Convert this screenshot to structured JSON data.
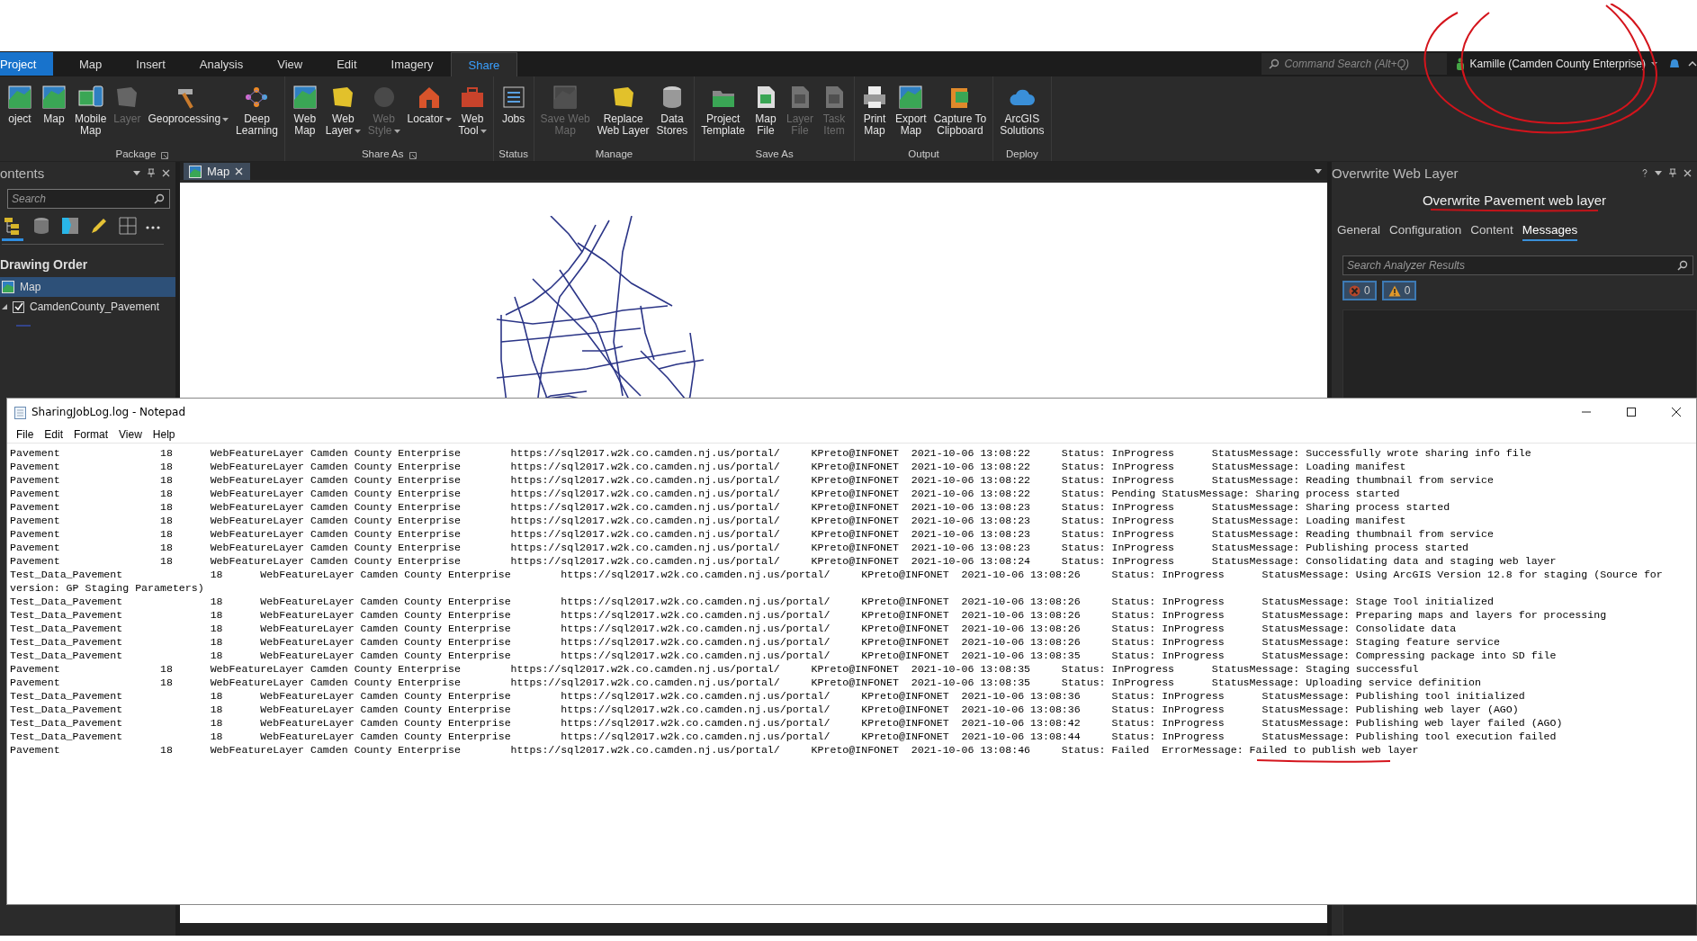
{
  "menu_tabs": [
    {
      "label": "Project",
      "kind": "backstage",
      "selected": false
    },
    {
      "label": "Map",
      "kind": "tab",
      "selected": false
    },
    {
      "label": "Insert",
      "kind": "tab",
      "selected": false
    },
    {
      "label": "Analysis",
      "kind": "tab",
      "selected": false
    },
    {
      "label": "View",
      "kind": "tab",
      "selected": false
    },
    {
      "label": "Edit",
      "kind": "tab",
      "selected": false
    },
    {
      "label": "Imagery",
      "kind": "tab",
      "selected": false
    },
    {
      "label": "Share",
      "kind": "tab",
      "selected": true
    }
  ],
  "command_search": {
    "placeholder": "Command Search (Alt+Q)"
  },
  "user": {
    "label": "Kamille (Camden County Enterprise)"
  },
  "ribbon_groups": [
    {
      "label": "Package",
      "launcher": true,
      "buttons": [
        {
          "label": "oject",
          "disabled": false,
          "dropdown": false
        },
        {
          "label": "Map",
          "disabled": false,
          "dropdown": false
        },
        {
          "label": "Mobile\nMap",
          "disabled": false,
          "dropdown": false
        },
        {
          "label": "Layer",
          "disabled": true,
          "dropdown": false
        },
        {
          "label": "Geoprocessing",
          "disabled": false,
          "dropdown": true
        },
        {
          "label": "Deep\nLearning",
          "disabled": false,
          "dropdown": false
        }
      ]
    },
    {
      "label": "Share As",
      "launcher": true,
      "buttons": [
        {
          "label": "Web\nMap",
          "disabled": false,
          "dropdown": false
        },
        {
          "label": "Web\nLayer",
          "disabled": false,
          "dropdown": true
        },
        {
          "label": "Web\nStyle",
          "disabled": true,
          "dropdown": true
        },
        {
          "label": "Locator",
          "disabled": false,
          "dropdown": true
        },
        {
          "label": "Web\nTool",
          "disabled": false,
          "dropdown": true
        }
      ]
    },
    {
      "label": "Status",
      "launcher": false,
      "buttons": [
        {
          "label": "Jobs",
          "disabled": false,
          "dropdown": false
        }
      ]
    },
    {
      "label": "Manage",
      "launcher": false,
      "buttons": [
        {
          "label": "Save Web\nMap",
          "disabled": true,
          "dropdown": false
        },
        {
          "label": "Replace\nWeb Layer",
          "disabled": false,
          "dropdown": false
        },
        {
          "label": "Data\nStores",
          "disabled": false,
          "dropdown": false
        }
      ]
    },
    {
      "label": "Save As",
      "launcher": false,
      "buttons": [
        {
          "label": "Project\nTemplate",
          "disabled": false,
          "dropdown": false
        },
        {
          "label": "Map\nFile",
          "disabled": false,
          "dropdown": false
        },
        {
          "label": "Layer\nFile",
          "disabled": true,
          "dropdown": false
        },
        {
          "label": "Task\nItem",
          "disabled": true,
          "dropdown": false
        }
      ]
    },
    {
      "label": "Output",
      "launcher": false,
      "buttons": [
        {
          "label": "Print\nMap",
          "disabled": false,
          "dropdown": false
        },
        {
          "label": "Export\nMap",
          "disabled": false,
          "dropdown": false
        },
        {
          "label": "Capture To\nClipboard",
          "disabled": false,
          "dropdown": false
        }
      ]
    },
    {
      "label": "Deploy",
      "launcher": false,
      "buttons": [
        {
          "label": "ArcGIS\nSolutions",
          "disabled": false,
          "dropdown": false
        }
      ]
    }
  ],
  "contents_pane": {
    "title": "ontents",
    "search": {
      "placeholder": "Search"
    },
    "view_buttons": [
      {
        "selected": true
      },
      {
        "selected": false
      },
      {
        "selected": false
      },
      {
        "selected": false
      },
      {
        "selected": false
      }
    ],
    "heading": "Drawing Order",
    "layers": [
      {
        "label": "Map",
        "kind": "map",
        "selected": true
      },
      {
        "label": "CamdenCounty_Pavement",
        "kind": "layer",
        "selected": false,
        "checked": true,
        "expanded": true
      }
    ]
  },
  "map_view": {
    "tab": "Map"
  },
  "overwrite_pane": {
    "title": "Overwrite Web Layer",
    "heading": "Overwrite Pavement web layer",
    "tabs": [
      {
        "label": "General",
        "selected": false
      },
      {
        "label": "Configuration",
        "selected": false
      },
      {
        "label": "Content",
        "selected": false
      },
      {
        "label": "Messages",
        "selected": true
      }
    ],
    "search": {
      "placeholder": "Search Analyzer Results"
    },
    "filters": [
      {
        "kind": "error",
        "count": "0",
        "selected": true
      },
      {
        "kind": "warning",
        "count": "0",
        "selected": true
      }
    ]
  },
  "notepad": {
    "title": "SharingJobLog.log - Notepad",
    "menu": [
      "File",
      "Edit",
      "Format",
      "View",
      "Help"
    ],
    "lines": [
      "Pavement\t\t18\tWebFeatureLayer Camden County Enterprise\thttps://sql2017.w2k.co.camden.nj.us/portal/\tKPreto@INFONET  2021-10-06 13:08:22\tStatus: InProgress\tStatusMessage: Successfully wrote sharing info file",
      "Pavement\t\t18\tWebFeatureLayer Camden County Enterprise\thttps://sql2017.w2k.co.camden.nj.us/portal/\tKPreto@INFONET  2021-10-06 13:08:22\tStatus: InProgress\tStatusMessage: Loading manifest",
      "Pavement\t\t18\tWebFeatureLayer Camden County Enterprise\thttps://sql2017.w2k.co.camden.nj.us/portal/\tKPreto@INFONET  2021-10-06 13:08:22\tStatus: InProgress\tStatusMessage: Reading thumbnail from service",
      "Pavement\t\t18\tWebFeatureLayer Camden County Enterprise\thttps://sql2017.w2k.co.camden.nj.us/portal/\tKPreto@INFONET  2021-10-06 13:08:22\tStatus: Pending StatusMessage: Sharing process started",
      "Pavement\t\t18\tWebFeatureLayer Camden County Enterprise\thttps://sql2017.w2k.co.camden.nj.us/portal/\tKPreto@INFONET  2021-10-06 13:08:23\tStatus: InProgress\tStatusMessage: Sharing process started",
      "Pavement\t\t18\tWebFeatureLayer Camden County Enterprise\thttps://sql2017.w2k.co.camden.nj.us/portal/\tKPreto@INFONET  2021-10-06 13:08:23\tStatus: InProgress\tStatusMessage: Loading manifest",
      "Pavement\t\t18\tWebFeatureLayer Camden County Enterprise\thttps://sql2017.w2k.co.camden.nj.us/portal/\tKPreto@INFONET  2021-10-06 13:08:23\tStatus: InProgress\tStatusMessage: Reading thumbnail from service",
      "Pavement\t\t18\tWebFeatureLayer Camden County Enterprise\thttps://sql2017.w2k.co.camden.nj.us/portal/\tKPreto@INFONET  2021-10-06 13:08:23\tStatus: InProgress\tStatusMessage: Publishing process started",
      "Pavement\t\t18\tWebFeatureLayer Camden County Enterprise\thttps://sql2017.w2k.co.camden.nj.us/portal/\tKPreto@INFONET  2021-10-06 13:08:24\tStatus: InProgress\tStatusMessage: Consolidating data and staging web layer",
      "Test_Data_Pavement\t\t18\tWebFeatureLayer Camden County Enterprise\thttps://sql2017.w2k.co.camden.nj.us/portal/\tKPreto@INFONET  2021-10-06 13:08:26\tStatus: InProgress\tStatusMessage: Using ArcGIS Version 12.8 for staging (Source for",
      "version: GP Staging Parameters)",
      "Test_Data_Pavement\t\t18\tWebFeatureLayer Camden County Enterprise\thttps://sql2017.w2k.co.camden.nj.us/portal/\tKPreto@INFONET  2021-10-06 13:08:26\tStatus: InProgress\tStatusMessage: Stage Tool initialized",
      "Test_Data_Pavement\t\t18\tWebFeatureLayer Camden County Enterprise\thttps://sql2017.w2k.co.camden.nj.us/portal/\tKPreto@INFONET  2021-10-06 13:08:26\tStatus: InProgress\tStatusMessage: Preparing maps and layers for processing",
      "Test_Data_Pavement\t\t18\tWebFeatureLayer Camden County Enterprise\thttps://sql2017.w2k.co.camden.nj.us/portal/\tKPreto@INFONET  2021-10-06 13:08:26\tStatus: InProgress\tStatusMessage: Consolidate data",
      "Test_Data_Pavement\t\t18\tWebFeatureLayer Camden County Enterprise\thttps://sql2017.w2k.co.camden.nj.us/portal/\tKPreto@INFONET  2021-10-06 13:08:26\tStatus: InProgress\tStatusMessage: Staging feature service",
      "Test_Data_Pavement\t\t18\tWebFeatureLayer Camden County Enterprise\thttps://sql2017.w2k.co.camden.nj.us/portal/\tKPreto@INFONET  2021-10-06 13:08:35\tStatus: InProgress\tStatusMessage: Compressing package into SD file",
      "Pavement\t\t18\tWebFeatureLayer Camden County Enterprise\thttps://sql2017.w2k.co.camden.nj.us/portal/\tKPreto@INFONET  2021-10-06 13:08:35\tStatus: InProgress\tStatusMessage: Staging successful",
      "Pavement\t\t18\tWebFeatureLayer Camden County Enterprise\thttps://sql2017.w2k.co.camden.nj.us/portal/\tKPreto@INFONET  2021-10-06 13:08:35\tStatus: InProgress\tStatusMessage: Uploading service definition",
      "Test_Data_Pavement\t\t18\tWebFeatureLayer Camden County Enterprise\thttps://sql2017.w2k.co.camden.nj.us/portal/\tKPreto@INFONET  2021-10-06 13:08:36\tStatus: InProgress\tStatusMessage: Publishing tool initialized",
      "Test_Data_Pavement\t\t18\tWebFeatureLayer Camden County Enterprise\thttps://sql2017.w2k.co.camden.nj.us/portal/\tKPreto@INFONET  2021-10-06 13:08:36\tStatus: InProgress\tStatusMessage: Publishing web layer (AGO)",
      "Test_Data_Pavement\t\t18\tWebFeatureLayer Camden County Enterprise\thttps://sql2017.w2k.co.camden.nj.us/portal/\tKPreto@INFONET  2021-10-06 13:08:42\tStatus: InProgress\tStatusMessage: Publishing web layer failed (AGO)",
      "Test_Data_Pavement\t\t18\tWebFeatureLayer Camden County Enterprise\thttps://sql2017.w2k.co.camden.nj.us/portal/\tKPreto@INFONET  2021-10-06 13:08:44\tStatus: InProgress\tStatusMessage: Publishing tool execution failed",
      "Pavement\t\t18\tWebFeatureLayer Camden County Enterprise\thttps://sql2017.w2k.co.camden.nj.us/portal/\tKPreto@INFONET  2021-10-06 13:08:46\tStatus: Failed  ErrorMessage: Failed to publish web layer"
    ]
  }
}
